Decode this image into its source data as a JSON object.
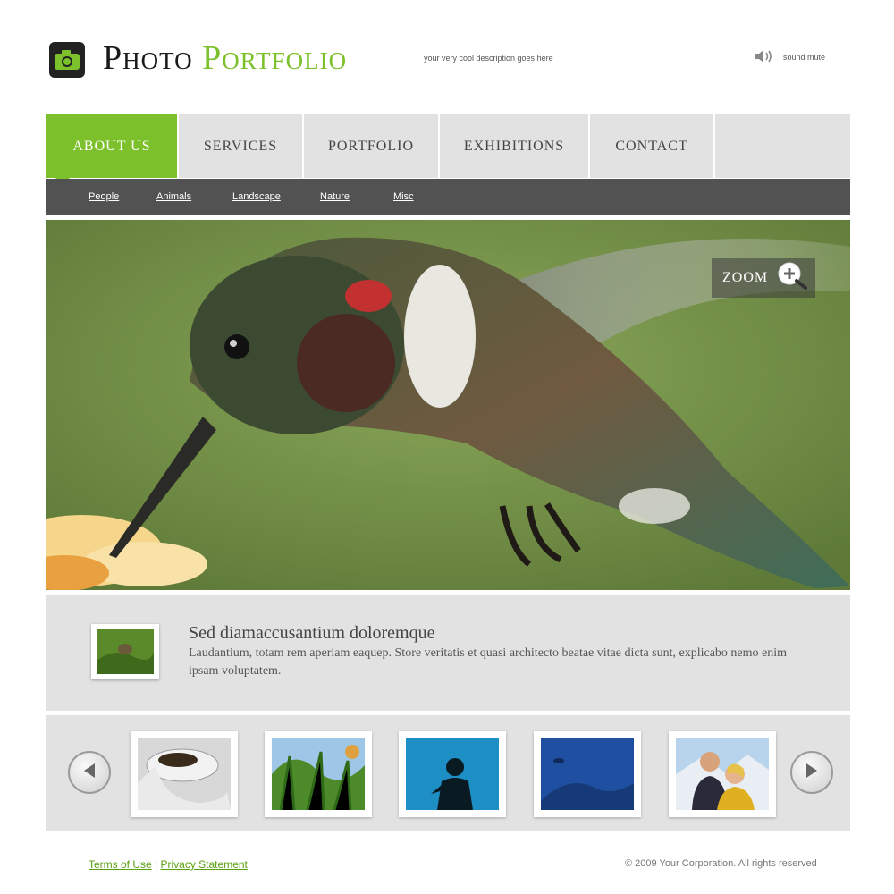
{
  "header": {
    "brand_word1": "Photo",
    "brand_word2": "Portfolio",
    "tagline": "your very cool description goes here",
    "sound_label": "sound mute"
  },
  "nav": {
    "items": [
      {
        "label": "ABOUT US",
        "active": true
      },
      {
        "label": "SERVICES",
        "active": false
      },
      {
        "label": "PORTFOLIO",
        "active": false
      },
      {
        "label": "EXHIBITIONS",
        "active": false
      },
      {
        "label": "CONTACT",
        "active": false
      }
    ]
  },
  "subnav": {
    "items": [
      "People",
      "Animals",
      "Landscape",
      "Nature",
      "Misc"
    ]
  },
  "hero": {
    "zoom_label": "ZOOM"
  },
  "caption": {
    "title": "Sed diamaccusantium doloremque",
    "body": "Laudantium, totam rem aperiam eaquep. Store veritatis et quasi architecto beatae vitae dicta sunt, explicabo nemo enim ipsam voluptatem."
  },
  "footer": {
    "terms_label": "Terms of Use",
    "separator": "|",
    "privacy_label": "Privacy Statement",
    "copyright": "© 2009 Your Corporation. All rights reserved"
  },
  "colors": {
    "accent": "#7cc12b",
    "nav_bg": "#e2e2e2",
    "subnav_bg": "#525252"
  }
}
